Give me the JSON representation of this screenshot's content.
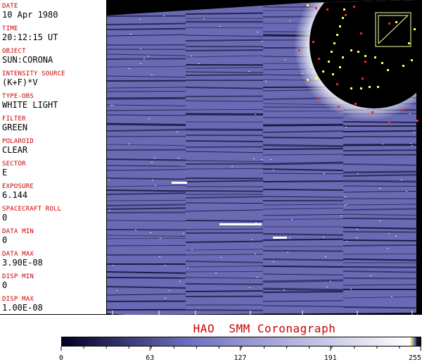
{
  "header_fields": [
    {
      "label": "DATE",
      "value": "10 Apr 1980"
    },
    {
      "label": "TIME",
      "value": "20:12:15 UT"
    },
    {
      "label": "OBJECT",
      "value": "SUN:CORONA"
    },
    {
      "label": "INTENSITY SOURCE",
      "value": "(K+F)*V"
    },
    {
      "label": "TYPE-OBS",
      "value": "WHITE LIGHT"
    },
    {
      "label": "FILTER",
      "value": "GREEN"
    },
    {
      "label": "POLAROID",
      "value": "CLEAR"
    },
    {
      "label": "SECTOR",
      "value": "E"
    },
    {
      "label": "EXPOSURE",
      "value": "6.144"
    },
    {
      "label": "SPACECRAFT ROLL",
      "value": "0"
    },
    {
      "label": "DATA MIN",
      "value": "0"
    },
    {
      "label": "DATA MAX",
      "value": "3.90E-08"
    },
    {
      "label": "DISP MIN",
      "value": "0"
    },
    {
      "label": "DISP MAX",
      "value": "1.00E-08"
    }
  ],
  "plot_title": "HAO  SMM Coronagraph",
  "colorbar": {
    "ticks": [
      "0",
      "63",
      "127",
      "191",
      "255"
    ],
    "colors": {
      "dark": "#000022",
      "mid": "#6e6ec0",
      "light": "#ffffff"
    }
  },
  "colors": {
    "label_red": "#cc0000",
    "image_blue": "#6a6ab4",
    "marker_red": "#ff2222",
    "marker_yellow": "#ffff55"
  }
}
